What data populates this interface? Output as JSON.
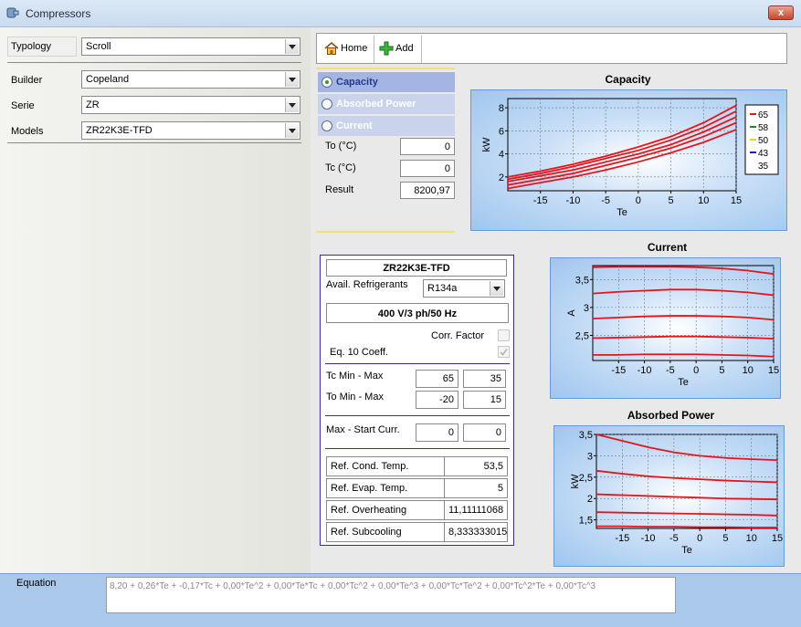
{
  "window": {
    "title": "Compressors",
    "close_label": "x"
  },
  "filters": {
    "typology": {
      "label": "Typology",
      "value": "Scroll"
    },
    "builder": {
      "label": "Builder",
      "value": "Copeland"
    },
    "serie": {
      "label": "Serie",
      "value": "ZR"
    },
    "models": {
      "label": "Models",
      "value": "ZR22K3E-TFD"
    }
  },
  "toolbar": {
    "home_label": "Home",
    "add_label": "Add"
  },
  "modes": [
    {
      "label": "Capacity",
      "selected": true
    },
    {
      "label": "Absorbed Power",
      "selected": false
    },
    {
      "label": "Current",
      "selected": false
    }
  ],
  "calc": {
    "to_label": "To (°C)",
    "to_value": "0",
    "tc_label": "Tc (°C)",
    "tc_value": "0",
    "result_label": "Result",
    "result_value": "8200,97"
  },
  "details": {
    "model": "ZR22K3E-TFD",
    "refrigerants_label": "Avail. Refrigerants",
    "refrigerant": "R134a",
    "power_supply": "400 V/3 ph/50 Hz",
    "corr_factor_label": "Corr. Factor",
    "eq10_label": "Eq. 10 Coeff.",
    "tc_range_label": "Tc Min - Max",
    "tc_min": "65",
    "tc_max": "35",
    "to_range_label": "To Min - Max",
    "to_min": "-20",
    "to_max": "15",
    "curr_label": "Max - Start Curr.",
    "curr_max": "0",
    "curr_start": "0",
    "ref_table": [
      {
        "label": "Ref. Cond. Temp.",
        "value": "53,5"
      },
      {
        "label": "Ref. Evap. Temp.",
        "value": "5"
      },
      {
        "label": "Ref. Overheating",
        "value": "11,11111068"
      },
      {
        "label": "Ref. Subcooling",
        "value": "8,333333015"
      }
    ]
  },
  "equation": {
    "label": "Equation",
    "value": "8,20 + 0,26*Te + -0,17*Tc + 0,00*Te^2 + 0,00*Te*Tc + 0,00*Tc^2 + 0,00*Te^3 + 0,00*Tc*Te^2 + 0,00*Tc^2*Te + 0,00*Tc^3"
  },
  "colors": {
    "curve": "#e8141b",
    "accent": "#243a8f"
  },
  "chart_data": [
    {
      "type": "line",
      "title": "Capacity",
      "xlabel": "Te",
      "ylabel": "kW",
      "xlim": [
        -20,
        15
      ],
      "ylim": [
        0.8,
        8.8
      ],
      "xticks": [
        -15,
        -10,
        -5,
        0,
        5,
        10,
        15
      ],
      "yticks": [
        2,
        4,
        6,
        8
      ],
      "grid": true,
      "legend": "right",
      "x": [
        -20,
        -15,
        -10,
        -5,
        0,
        5,
        10,
        15
      ],
      "series": [
        {
          "name": "65",
          "color": "#e8141b",
          "values": [
            2.0,
            2.5,
            3.1,
            3.8,
            4.6,
            5.5,
            6.7,
            8.2
          ]
        },
        {
          "name": "58",
          "color": "#1a8a1a",
          "values": [
            1.8,
            2.3,
            2.9,
            3.6,
            4.3,
            5.2,
            6.3,
            7.7
          ]
        },
        {
          "name": "50",
          "color": "#e8d81b",
          "values": [
            1.6,
            2.1,
            2.6,
            3.3,
            4.0,
            4.8,
            5.9,
            7.2
          ]
        },
        {
          "name": "43",
          "color": "#1a1ac8",
          "values": [
            1.3,
            1.8,
            2.3,
            3.0,
            3.7,
            4.5,
            5.5,
            6.7
          ]
        },
        {
          "name": "35",
          "color": "#ffffff",
          "values": [
            1.0,
            1.5,
            2.0,
            2.6,
            3.3,
            4.1,
            5.0,
            6.1
          ]
        }
      ]
    },
    {
      "type": "line",
      "title": "Current",
      "xlabel": "Te",
      "ylabel": "A",
      "xlim": [
        -20,
        15
      ],
      "ylim": [
        2.05,
        3.75
      ],
      "xticks": [
        -15,
        -10,
        -5,
        0,
        5,
        10,
        15
      ],
      "yticks": [
        2.5,
        3,
        3.5
      ],
      "ytick_labels": [
        "2,5",
        "3",
        "3,5"
      ],
      "grid": true,
      "x": [
        -20,
        -15,
        -10,
        -5,
        0,
        5,
        10,
        15
      ],
      "series": [
        {
          "values": [
            3.72,
            3.73,
            3.73,
            3.73,
            3.72,
            3.7,
            3.66,
            3.6
          ]
        },
        {
          "values": [
            3.25,
            3.28,
            3.3,
            3.32,
            3.32,
            3.3,
            3.27,
            3.22
          ]
        },
        {
          "values": [
            2.8,
            2.82,
            2.84,
            2.85,
            2.85,
            2.84,
            2.82,
            2.78
          ]
        },
        {
          "values": [
            2.45,
            2.46,
            2.47,
            2.48,
            2.48,
            2.47,
            2.46,
            2.44
          ]
        },
        {
          "values": [
            2.15,
            2.15,
            2.16,
            2.16,
            2.16,
            2.15,
            2.14,
            2.12
          ]
        }
      ]
    },
    {
      "type": "line",
      "title": "Absorbed Power",
      "xlabel": "Te",
      "ylabel": "kW",
      "xlim": [
        -20,
        15
      ],
      "ylim": [
        1.3,
        3.5
      ],
      "xticks": [
        -15,
        -10,
        -5,
        0,
        5,
        10,
        15
      ],
      "yticks": [
        1.5,
        2,
        2.5,
        3,
        3.5
      ],
      "ytick_labels": [
        "1,5",
        "2",
        "2,5",
        "3",
        "3,5"
      ],
      "grid": true,
      "x": [
        -20,
        -15,
        -10,
        -5,
        0,
        5,
        10,
        15
      ],
      "series": [
        {
          "values": [
            3.5,
            3.35,
            3.2,
            3.08,
            3.0,
            2.95,
            2.92,
            2.9
          ]
        },
        {
          "values": [
            2.65,
            2.58,
            2.52,
            2.48,
            2.45,
            2.42,
            2.4,
            2.38
          ]
        },
        {
          "values": [
            2.1,
            2.08,
            2.06,
            2.04,
            2.02,
            2.0,
            1.99,
            1.98
          ]
        },
        {
          "values": [
            1.68,
            1.67,
            1.66,
            1.65,
            1.64,
            1.63,
            1.62,
            1.6
          ]
        },
        {
          "values": [
            1.35,
            1.35,
            1.34,
            1.34,
            1.33,
            1.33,
            1.32,
            1.32
          ]
        }
      ]
    }
  ]
}
